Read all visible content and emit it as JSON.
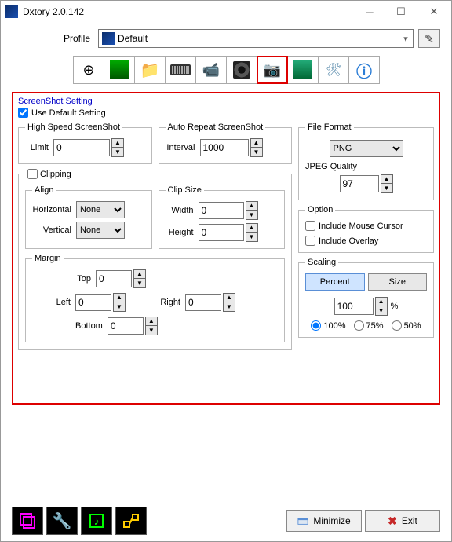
{
  "title": "Dxtory 2.0.142",
  "profile": {
    "label": "Profile",
    "value": "Default"
  },
  "panel": {
    "title": "ScreenShot Setting",
    "use_default": "Use Default Setting",
    "use_default_checked": true
  },
  "highspeed": {
    "legend": "High Speed ScreenShot",
    "limit_label": "Limit",
    "limit": "0"
  },
  "autorepeat": {
    "legend": "Auto Repeat ScreenShot",
    "interval_label": "Interval",
    "interval": "1000"
  },
  "clipping": {
    "legend": "Clipping",
    "align_legend": "Align",
    "clipsize_legend": "Clip Size",
    "horizontal_label": "Horizontal",
    "vertical_label": "Vertical",
    "align_h": "None",
    "align_v": "None",
    "width_label": "Width",
    "height_label": "Height",
    "width": "0",
    "height": "0",
    "margin_legend": "Margin",
    "top_label": "Top",
    "left_label": "Left",
    "right_label": "Right",
    "bottom_label": "Bottom",
    "top": "0",
    "left": "0",
    "right": "0",
    "bottom": "0"
  },
  "fileformat": {
    "legend": "File Format",
    "value": "PNG",
    "jpeg_label": "JPEG Quality",
    "jpeg": "97"
  },
  "option": {
    "legend": "Option",
    "mouse": "Include Mouse Cursor",
    "overlay": "Include Overlay"
  },
  "scaling": {
    "legend": "Scaling",
    "percent": "Percent",
    "size": "Size",
    "value": "100",
    "unit": "%",
    "r100": "100%",
    "r75": "75%",
    "r50": "50%"
  },
  "bottom": {
    "minimize": "Minimize",
    "exit": "Exit"
  }
}
